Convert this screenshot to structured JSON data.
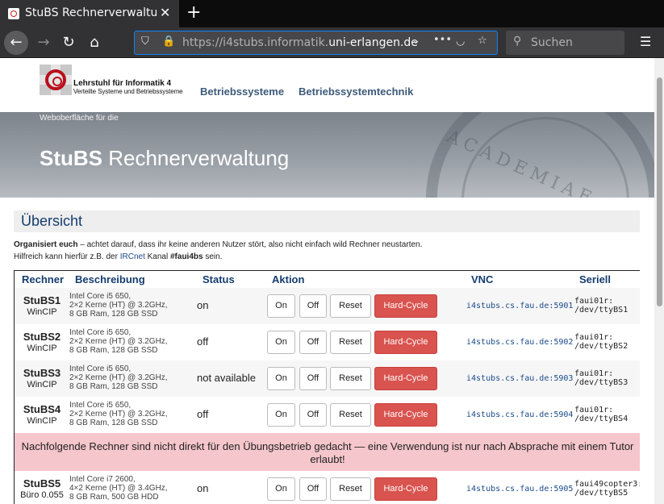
{
  "browser": {
    "tab_title": "StuBS Rechnerverwaltung",
    "tab_close": "✕",
    "new_tab": "+",
    "url_prefix": "https://i4stubs.informatik.",
    "url_domain": "uni-erlangen.de",
    "search_placeholder": "Suchen"
  },
  "header": {
    "chair_name": "Lehrstuhl für Informatik 4",
    "chair_sub": "Verteilte Systeme und Betriebssysteme",
    "nav": [
      "Betriebssysteme",
      "Betriebssystemtechnik"
    ]
  },
  "banner": {
    "pre": "Weboberfläche für die",
    "title_bold": "StuBS",
    "title_rest": " Rechnerverwaltung",
    "seal_text": "ACADEMIAE FRIDERICO"
  },
  "overview": {
    "heading": "Übersicht",
    "line1_bold": "Organisiert euch",
    "line1_rest": " – achtet darauf, dass ihr keine anderen Nutzer stört, also nicht einfach wild Rechner neustarten.",
    "line2_a": "Hilfreich kann hierfür z.B. der ",
    "line2_link": "IRCnet",
    "line2_b": " Kanal ",
    "line2_channel": "#faui4bs",
    "line2_c": " sein."
  },
  "table": {
    "headers": [
      "Rechner",
      "Beschreibung",
      "Status",
      "Aktion",
      "VNC",
      "Seriell"
    ],
    "buttons": {
      "on": "On",
      "off": "Off",
      "reset": "Reset",
      "hard": "Hard-Cycle"
    },
    "rows": [
      {
        "name": "StuBS1",
        "room": "WinCIP",
        "desc1": "Intel Core i5 650,",
        "desc2": "2×2 Kerne (HT) @ 3.2GHz,",
        "desc3": "8 GB Ram, 128 GB SSD",
        "status": "on",
        "vnc": "i4stubs.cs.fau.de:5901",
        "serial": "faui01r:\n/dev/ttyBS1"
      },
      {
        "name": "StuBS2",
        "room": "WinCIP",
        "desc1": "Intel Core i5 650,",
        "desc2": "2×2 Kerne (HT) @ 3.2GHz,",
        "desc3": "8 GB Ram, 128 GB SSD",
        "status": "off",
        "vnc": "i4stubs.cs.fau.de:5902",
        "serial": "faui01r:\n/dev/ttyBS2"
      },
      {
        "name": "StuBS3",
        "room": "WinCIP",
        "desc1": "Intel Core i5 650,",
        "desc2": "2×2 Kerne (HT) @ 3.2GHz,",
        "desc3": "8 GB Ram, 128 GB SSD",
        "status": "not available",
        "vnc": "i4stubs.cs.fau.de:5903",
        "serial": "faui01r:\n/dev/ttyBS3"
      },
      {
        "name": "StuBS4",
        "room": "WinCIP",
        "desc1": "Intel Core i5 650,",
        "desc2": "2×2 Kerne (HT) @ 3.2GHz,",
        "desc3": "8 GB Ram, 128 GB SSD",
        "status": "off",
        "vnc": "i4stubs.cs.fau.de:5904",
        "serial": "faui01r:\n/dev/ttyBS4"
      },
      {
        "name": "StuBS5",
        "room": "Büro 0.055",
        "desc1": "Intel Core i7 2600,",
        "desc2": "4×2 Kerne (HT) @ 3.4GHz,",
        "desc3": "8 GB Ram, 500 GB HDD",
        "status": "on",
        "vnc": "i4stubs.cs.fau.de:5905",
        "serial": "faui49copter3:\n/dev/ttyBS5"
      }
    ],
    "notice": "Nachfolgende Rechner sind nicht direkt für den Übungsbetrieb gedacht — eine Verwendung ist nur nach Absprache mit einem Tutor erlaubt!"
  }
}
